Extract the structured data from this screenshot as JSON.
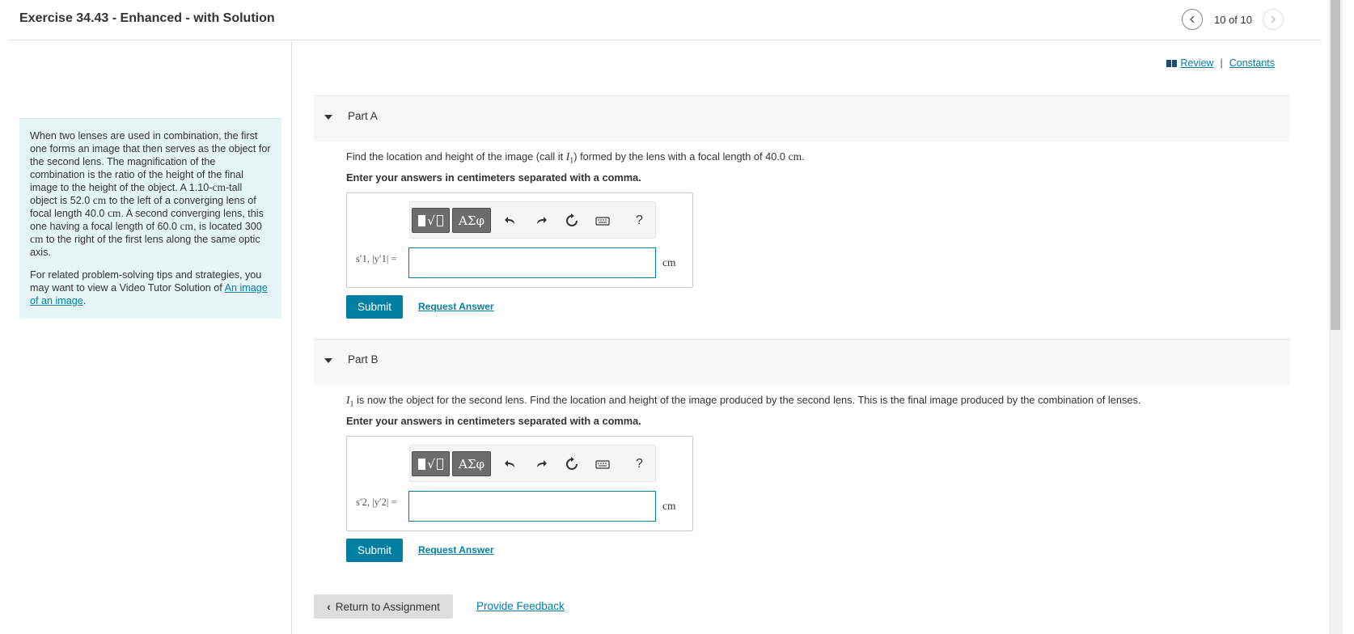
{
  "header": {
    "title": "Exercise 34.43 - Enhanced - with Solution",
    "pager": "10 of 10",
    "prev_icon": "chevron-left-icon",
    "next_icon": "chevron-right-icon"
  },
  "scenario": {
    "p1_a": "When two lenses are used in combination, the first one forms an image that then serves as the object for the second lens. The magnification of the combination is the ratio of the height of the final image to the height of the object. A 1.10-",
    "unit_cm": "cm",
    "p1_b": "-tall object is 52.0 ",
    "p1_c": " to the left of a converging lens of focal length 40.0 ",
    "p1_d": ". A second converging lens, this one having a focal length of 60.0 ",
    "p1_e": ", is located 300 ",
    "p1_f": " to the right of the first lens along the same optic axis.",
    "p2": "For related problem-solving tips and strategies, you may want to view a Video Tutor Solution of ",
    "link": "An image of an image",
    "period": "."
  },
  "toplinks": {
    "review": "Review",
    "separator": "|",
    "constants": "Constants",
    "review_icon": "book-icon"
  },
  "partA": {
    "title": "Part A",
    "question_a": "Find the location and height of the image (call it ",
    "math_I": "I",
    "math_sub": "1",
    "question_b": ") formed by the lens with a focal length of 40.0 ",
    "unit": "cm",
    "question_end": ".",
    "instruction": "Enter your answers in centimeters separated with a comma.",
    "answer_label": "s′1, |y′1| =",
    "answer_value": "",
    "unit_label": "cm",
    "submit": "Submit",
    "request": "Request Answer"
  },
  "partB": {
    "title": "Part B",
    "math_I": "I",
    "math_sub": "1",
    "question": " is now the object for the second lens. Find the location and height of the image produced by the second lens. This is the final image produced by the combination of lenses.",
    "instruction": "Enter your answers in centimeters separated with a comma.",
    "answer_label": "s′2, |y′2| =",
    "answer_value": "",
    "unit_label": "cm",
    "submit": "Submit",
    "request": "Request Answer"
  },
  "toolbar": {
    "greek": "ΑΣφ",
    "radical": "√",
    "help": "?"
  },
  "footer": {
    "return": "Return to Assignment",
    "feedback": "Provide Feedback"
  }
}
